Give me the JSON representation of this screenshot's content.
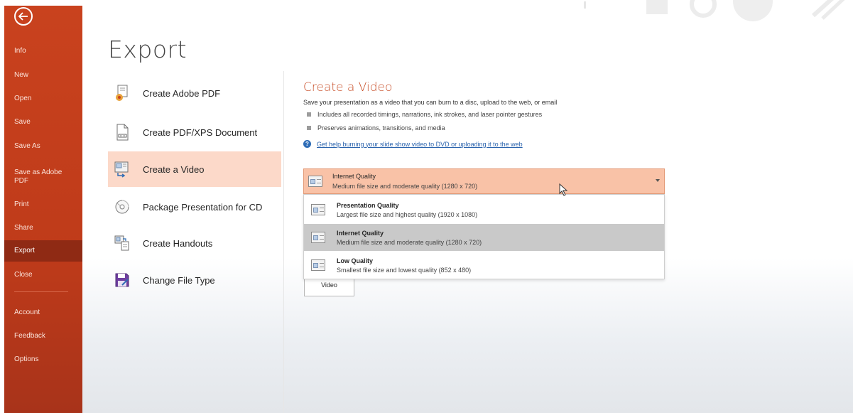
{
  "nav": {
    "items": [
      {
        "label": "Info"
      },
      {
        "label": "New"
      },
      {
        "label": "Open"
      },
      {
        "label": "Save"
      },
      {
        "label": "Save As"
      },
      {
        "label": "Save as Adobe PDF"
      },
      {
        "label": "Print"
      },
      {
        "label": "Share"
      },
      {
        "label": "Export",
        "active": true
      },
      {
        "label": "Close"
      },
      {
        "label": "Account"
      },
      {
        "label": "Feedback"
      },
      {
        "label": "Options"
      }
    ],
    "accent": "#c9421e",
    "active_bg": "#8f2a14"
  },
  "page": {
    "title": "Export"
  },
  "options": [
    {
      "label": "Create Adobe PDF",
      "icon": "adobe-pdf-icon"
    },
    {
      "label": "Create PDF/XPS Document",
      "icon": "pdf-xps-document-icon"
    },
    {
      "label": "Create a Video",
      "icon": "video-icon",
      "active": true
    },
    {
      "label": "Package Presentation for CD",
      "icon": "cd-icon"
    },
    {
      "label": "Create Handouts",
      "icon": "handouts-icon"
    },
    {
      "label": "Change File Type",
      "icon": "save-file-type-icon"
    }
  ],
  "video": {
    "title": "Create a Video",
    "description": "Save your presentation as a video that you can burn to a disc, upload to the web, or email",
    "bullets": [
      "Includes all recorded timings, narrations, ink strokes, and laser pointer gestures",
      "Preserves animations, transitions, and media"
    ],
    "help_link": "Get help burning your slide show video to DVD or uploading it to the web",
    "quality": {
      "selected": {
        "title": "Internet Quality",
        "subtitle": "Medium file size and moderate quality (1280 x 720)"
      },
      "options": [
        {
          "title": "Presentation Quality",
          "subtitle": "Largest file size and highest quality (1920 x 1080)"
        },
        {
          "title": "Internet Quality",
          "subtitle": "Medium file size and moderate quality (1280 x 720)",
          "selected": true
        },
        {
          "title": "Low Quality",
          "subtitle": "Smallest file size and lowest quality (852 x 480)"
        }
      ]
    },
    "create_button": "Video"
  },
  "colors": {
    "section_title": "#c9502a",
    "dropdown_selected": "#f9c2a7",
    "option_active": "#fcd9c9",
    "link": "#2a63ad"
  }
}
